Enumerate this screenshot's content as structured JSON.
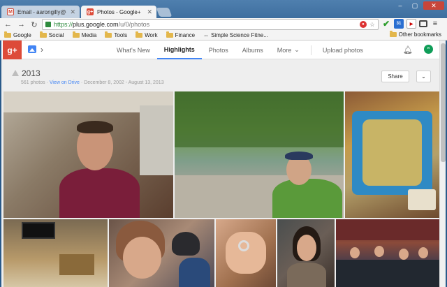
{
  "browser": {
    "tabs": [
      {
        "title": "Email - aarongilly@gmai",
        "icon": "gmail-icon",
        "active": false
      },
      {
        "title": "Photos - Google+",
        "icon": "google-plus-icon",
        "active": true
      }
    ],
    "url": {
      "scheme": "https://",
      "host": "plus.google.com",
      "path": "/u/0/photos"
    },
    "bookmarks": [
      "Google",
      "Social",
      "Media",
      "Tools",
      "Work",
      "Finance"
    ],
    "bookmark_link": "Simple Science Fitne...",
    "other_bookmarks": "Other bookmarks"
  },
  "gplus": {
    "logo": "g+",
    "nav": [
      {
        "label": "What's New",
        "active": false
      },
      {
        "label": "Highlights",
        "active": true
      },
      {
        "label": "Photos",
        "active": false
      },
      {
        "label": "Albums",
        "active": false
      },
      {
        "label": "More",
        "active": false
      }
    ],
    "upload": "Upload photos"
  },
  "album": {
    "title": "2013",
    "count": "561 photos",
    "drive_link": "View on Drive",
    "date_range": "December 8, 2002 - August 13, 2013",
    "share_label": "Share"
  },
  "photos": [
    {
      "name": "man-in-living-room"
    },
    {
      "name": "selfie-by-river"
    },
    {
      "name": "board-game-catan"
    },
    {
      "name": "room-with-tv"
    },
    {
      "name": "woman-and-child"
    },
    {
      "name": "hand-with-ring"
    },
    {
      "name": "woman-smiling"
    },
    {
      "name": "group-on-stage"
    }
  ],
  "colors": {
    "gplus_red": "#dd4b39",
    "active_tab_underline": "#4285f4",
    "link": "#4285f4"
  }
}
